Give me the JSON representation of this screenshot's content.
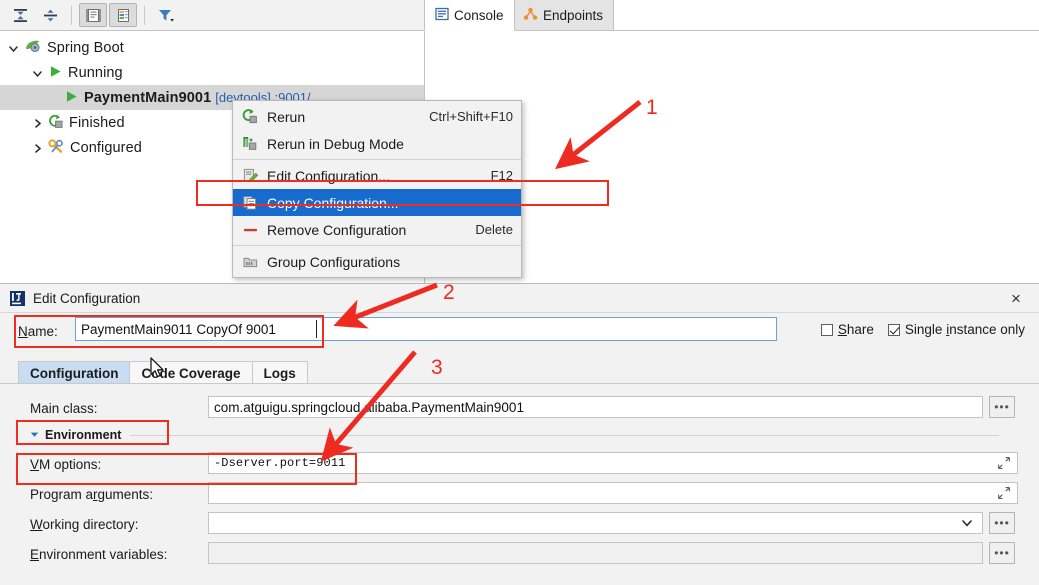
{
  "run_window": {
    "toolbar": {
      "buttons": [
        {
          "name": "expand-all-icon",
          "title": "Expand All"
        },
        {
          "name": "collapse-all-icon",
          "title": "Collapse All"
        },
        {
          "name": "show-console-icon",
          "title": "Show Console"
        },
        {
          "name": "show-output-icon",
          "title": "Show Output"
        },
        {
          "name": "filter-icon",
          "title": "Filter"
        }
      ]
    },
    "tabs": [
      {
        "label": "Console",
        "icon": "console-icon",
        "active": true
      },
      {
        "label": "Endpoints",
        "icon": "endpoints-icon",
        "active": false
      }
    ],
    "tree": [
      {
        "label": "Spring Boot",
        "icon": "spring-boot-icon",
        "expanded": true,
        "depth": 0
      },
      {
        "label": "Running",
        "icon": "run-icon",
        "expanded": true,
        "depth": 1
      },
      {
        "label": "PaymentMain9001",
        "sub": "[devtools] :9001/",
        "icon": "run-icon",
        "depth": 2,
        "selected": true
      },
      {
        "label": "Finished",
        "icon": "finished-icon",
        "expanded": false,
        "depth": 1
      },
      {
        "label": "Configured",
        "icon": "configured-icon",
        "expanded": false,
        "depth": 1
      }
    ]
  },
  "context_menu": {
    "items": [
      {
        "label": "Rerun",
        "accel": "Ctrl+Shift+F10",
        "icon": "rerun-icon",
        "highlighted": false
      },
      {
        "label": "Rerun in Debug Mode",
        "accel": "",
        "icon": "debug-icon",
        "highlighted": false
      },
      {
        "label": "Edit Configuration...",
        "accel": "F12",
        "icon": "edit-configuration-icon",
        "highlighted": false
      },
      {
        "label": "Copy Configuration...",
        "accel": "",
        "icon": "copy-configuration-icon",
        "highlighted": true
      },
      {
        "label": "Remove Configuration",
        "accel": "Delete",
        "icon": "remove-configuration-icon",
        "highlighted": false
      },
      {
        "label": "Group Configurations",
        "accel": "",
        "icon": "group-configurations-icon",
        "highlighted": false
      }
    ]
  },
  "dialog": {
    "title": "Edit Configuration",
    "close_label": "×",
    "name_label": "Name:",
    "name_value": "PaymentMain9011 CopyOf 9001",
    "share_label": "Share",
    "share_checked": false,
    "single_instance_label": "Single instance only",
    "single_instance_checked": true,
    "tabs": [
      {
        "label": "Configuration",
        "selected": true
      },
      {
        "label": "Code Coverage",
        "selected": false
      },
      {
        "label": "Logs",
        "selected": false
      }
    ],
    "fields": [
      {
        "label": "Main class:",
        "value": "com.atguigu.springcloud.alibaba.PaymentMain9001",
        "trailing": "browse",
        "name": "main-class"
      },
      {
        "label": "VM options:",
        "value": "-Dserver.port=9011",
        "trailing": "expand",
        "name": "vm-options",
        "mono": true
      },
      {
        "label": "Program arguments:",
        "value": "",
        "trailing": "expand",
        "name": "program-arguments"
      },
      {
        "label": "Working directory:",
        "value": "",
        "trailing": "combo-browse",
        "name": "working-directory"
      },
      {
        "label": "Environment variables:",
        "value": "",
        "trailing": "browse",
        "name": "environment-variables",
        "disabled": true
      }
    ],
    "environment_section_label": "Environment",
    "ellipsis_label": "•••"
  },
  "annotations": {
    "accent_color": "#ee2b20",
    "markers": [
      {
        "number": "1",
        "target": "copy-configuration-menu-item"
      },
      {
        "number": "2",
        "target": "name-field"
      },
      {
        "number": "3",
        "target": "vm-options-field"
      }
    ]
  }
}
